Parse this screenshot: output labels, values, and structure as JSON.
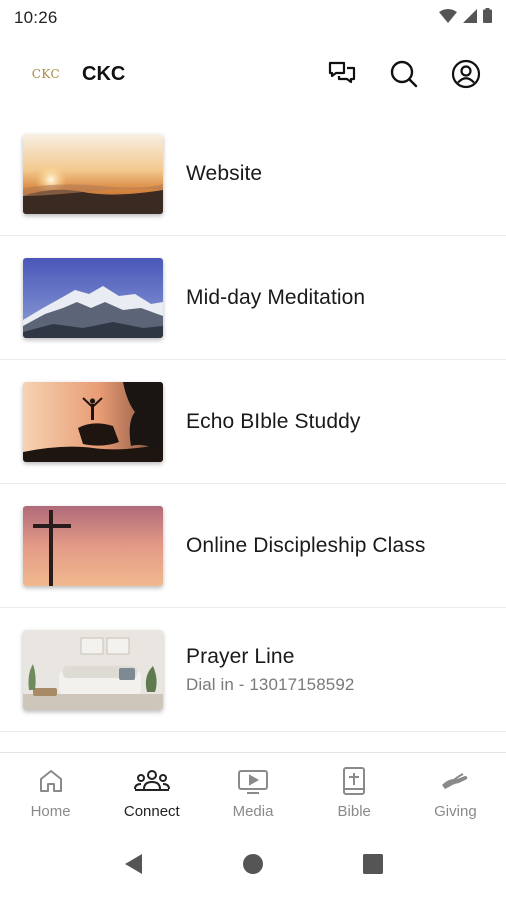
{
  "status": {
    "time": "10:26"
  },
  "header": {
    "logo_text": "CKC",
    "title": "CKC"
  },
  "items": [
    {
      "title": "Website",
      "subtitle": "",
      "image": "sunset-over-clouds"
    },
    {
      "title": "Mid-day Meditation",
      "subtitle": "",
      "image": "snowy-mountains"
    },
    {
      "title": "Echo BIble Studdy",
      "subtitle": "",
      "image": "person-on-rock-sunset"
    },
    {
      "title": "Online Discipleship Class",
      "subtitle": "",
      "image": "cross-at-sunset"
    },
    {
      "title": "Prayer Line",
      "subtitle": "Dial in - 13017158592",
      "image": "living-room"
    }
  ],
  "nav": {
    "items": [
      {
        "label": "Home",
        "icon": "home-icon",
        "active": false
      },
      {
        "label": "Connect",
        "icon": "people-icon",
        "active": true
      },
      {
        "label": "Media",
        "icon": "media-icon",
        "active": false
      },
      {
        "label": "Bible",
        "icon": "bible-icon",
        "active": false
      },
      {
        "label": "Giving",
        "icon": "giving-icon",
        "active": false
      }
    ]
  },
  "colors": {
    "active": "#222222",
    "inactive": "#8a8a8a",
    "divider": "#ececec"
  }
}
